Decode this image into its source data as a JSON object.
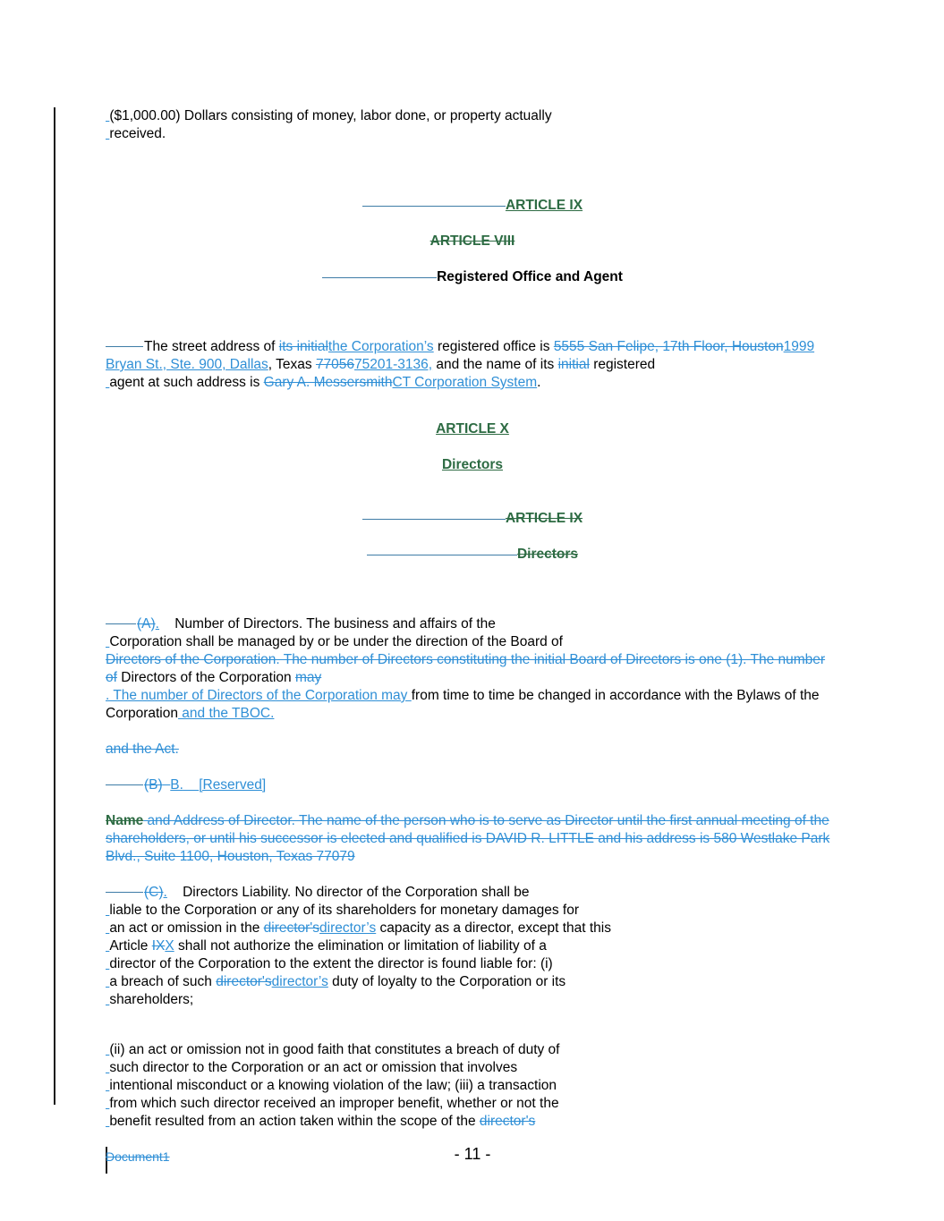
{
  "document": {
    "page_number": "- 11 -",
    "footer_filename": "Document1",
    "colors": {
      "insert_blue": "#2f8fd6",
      "insert_green": "#2d6b43",
      "change_bar": "#1a1a1a",
      "move_rule": "#3e7ca6",
      "body_text": "#000000"
    }
  },
  "intro": {
    "line1": "($1,000.00) Dollars consisting of money, labor done, or property actually",
    "line2": "received."
  },
  "headings": {
    "article_ix_ins": "ARTICLE IX",
    "article_viii_del": "ARTICLE VIII",
    "registered_office_and_agent": "Registered Office and Agent",
    "article_x_ins": "ARTICLE X",
    "directors_ins": "Directors",
    "article_ix_del": "ARTICLE IX",
    "directors_del": "Directors"
  },
  "registered_office": {
    "t1": "The street address of ",
    "del1": "its initial",
    "ins1": "the Corporation’s",
    "t2": " registered office is ",
    "del2": "5555 San Felipe, 17th Floor, Houston",
    "ins2": "1999 Bryan St., Ste. 900, Dallas",
    "t3": ", Texas ",
    "del3": "77056",
    "ins3": "75201-3136,",
    "t4": " and the name of its ",
    "del4": "initial",
    "t5": " registered",
    "t6": "agent at such address is ",
    "del5": "Gary A. Messersmith",
    "ins4": "CT Corporation System",
    "t7": "."
  },
  "section_a": {
    "label_del": "(A)",
    "label_ins": ".",
    "t1": "Number of Directors.  The business and affairs of the",
    "t2": "Corporation shall be managed by or be under the direction of the Board of",
    "del1": "Directors of the Corporation.  The number of Directors constituting the initial Board of Directors is one (1).  The number of",
    "t3": " Directors of the Corporation ",
    "del2": "may",
    "ins1": ".  The number of Directors of the Corporation may ",
    "t4": "from time to time be changed in accordance with the Bylaws of the Corporation",
    "ins2": " and the TBOC.",
    "del3": "and the Act."
  },
  "section_b": {
    "label_del": "(B)",
    "label_ins": "B.",
    "reserved_ins": "[Reserved]",
    "name_del_bold": "Name",
    "del_body": " and Address of Director. The name of the person who is to serve as Director until the first annual meeting of the shareholders, or until his successor is elected and qualified is DAVID R. LITTLE and his address is 580 Westlake Park Blvd., Suite 1100, Houston, Texas 77079"
  },
  "section_c": {
    "label_del": "(C)",
    "label_ins": ".",
    "t1": "Directors Liability.  No director of the Corporation shall be",
    "t2": "liable to the Corporation or any of its shareholders for monetary damages for",
    "t3": "an act or omission in the ",
    "del1": "director's",
    "ins1": "director’s",
    "t4": " capacity as a director, except that this",
    "t5": "Article ",
    "del2": "IX",
    "ins2": "X",
    "t6": " shall not authorize the elimination or limitation of liability of a",
    "t7": "director of the Corporation to the extent the director is found liable for: (i)",
    "t8": "a breach of such ",
    "del3": "director's",
    "ins3": "director’s",
    "t9": " duty of loyalty to the Corporation or its",
    "t10": "shareholders;"
  },
  "section_c2": {
    "t1": "(ii) an act or omission not in good faith that constitutes a breach of duty of",
    "t2": "such director to the Corporation or an act or omission that involves",
    "t3": "intentional misconduct or a knowing violation of the law; (iii) a transaction",
    "t4": "from which such director received an improper benefit, whether or not the",
    "t5": "benefit resulted from an action taken within the scope of the ",
    "del1": "director's"
  }
}
